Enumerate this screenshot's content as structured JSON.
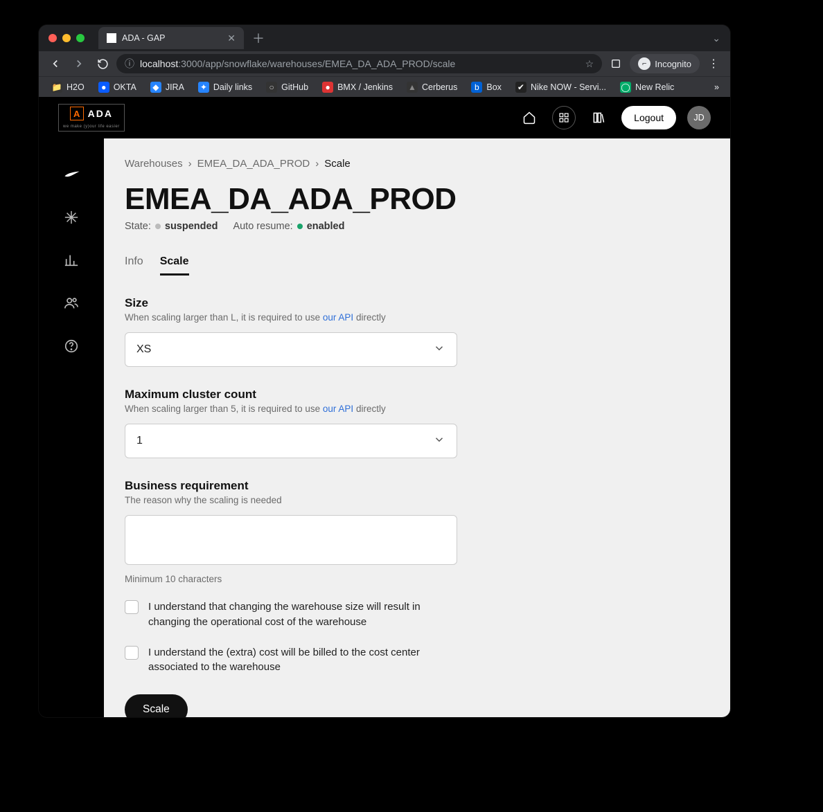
{
  "browser": {
    "tab_title": "ADA - GAP",
    "url_host": "localhost",
    "url_port_path": ":3000/app/snowflake/warehouses/EMEA_DA_ADA_PROD/scale",
    "incognito_label": "Incognito",
    "bookmarks": [
      {
        "label": "H2O",
        "bg": "#333",
        "fg": "#ccc",
        "glyph": "📁"
      },
      {
        "label": "OKTA",
        "bg": "#0a5cff",
        "fg": "#fff",
        "glyph": "●"
      },
      {
        "label": "JIRA",
        "bg": "#2684ff",
        "fg": "#fff",
        "glyph": "◆"
      },
      {
        "label": "Daily links",
        "bg": "#2684ff",
        "fg": "#fff",
        "glyph": "✦"
      },
      {
        "label": "GitHub",
        "bg": "#333",
        "fg": "#ccc",
        "glyph": "○"
      },
      {
        "label": "BMX / Jenkins",
        "bg": "#d33",
        "fg": "#fff",
        "glyph": "●"
      },
      {
        "label": "Cerberus",
        "bg": "#333",
        "fg": "#888",
        "glyph": "▲"
      },
      {
        "label": "Box",
        "bg": "#0061d5",
        "fg": "#fff",
        "glyph": "b"
      },
      {
        "label": "Nike NOW - Servi...",
        "bg": "#222",
        "fg": "#fff",
        "glyph": "✔"
      },
      {
        "label": "New Relic",
        "bg": "#00ac69",
        "fg": "#fff",
        "glyph": "◯"
      }
    ]
  },
  "header": {
    "logo_text": "ADA",
    "logo_sub": "we make (y)our life easier",
    "logout_label": "Logout",
    "avatar_initials": "JD"
  },
  "breadcrumb": {
    "items": [
      "Warehouses",
      "EMEA_DA_ADA_PROD"
    ],
    "current": "Scale"
  },
  "page": {
    "title": "EMEA_DA_ADA_PROD",
    "state_label": "State:",
    "state_value": "suspended",
    "autoresume_label": "Auto resume:",
    "autoresume_value": "enabled"
  },
  "tabs": {
    "info": "Info",
    "scale": "Scale"
  },
  "form": {
    "size": {
      "label": "Size",
      "help_prefix": "When scaling larger than L, it is required to use ",
      "help_link": "our API",
      "help_suffix": " directly",
      "value": "XS"
    },
    "cluster": {
      "label": "Maximum cluster count",
      "help_prefix": "When scaling larger than 5, it is required to use ",
      "help_link": "our API",
      "help_suffix": " directly",
      "value": "1"
    },
    "reason": {
      "label": "Business requirement",
      "help": "The reason why the scaling is needed",
      "value": "",
      "min_help": "Minimum 10 characters"
    },
    "ack1": "I understand that changing the warehouse size will result in changing the operational cost of the warehouse",
    "ack2": "I understand the (extra) cost will be billed to the cost center associated to the warehouse",
    "submit_label": "Scale"
  }
}
